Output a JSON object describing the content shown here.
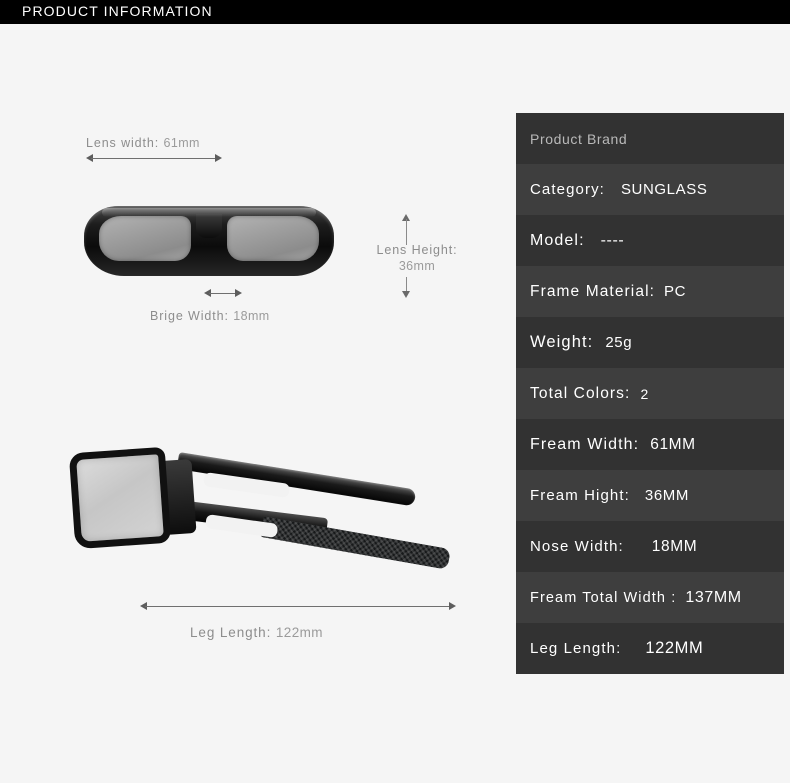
{
  "header": {
    "title": "PRODUCT INFORMATION"
  },
  "diagram": {
    "front_view": {
      "lens_width": {
        "label": "Lens width:",
        "value": "61mm"
      },
      "lens_height": {
        "label": "Lens Height:",
        "value": "36mm"
      },
      "bridge_width": {
        "label": "Brige Width:",
        "value": "18mm"
      }
    },
    "side_view": {
      "leg_length": {
        "label": "Leg Length:",
        "value": "122mm"
      }
    }
  },
  "spec_table": {
    "rows": [
      {
        "label": "Product Brand",
        "value": ""
      },
      {
        "label": "Category:",
        "value": "SUNGLASS"
      },
      {
        "label": "Model:",
        "value": "----"
      },
      {
        "label": "Frame Material:",
        "value": "PC"
      },
      {
        "label": "Weight:",
        "value": "25g"
      },
      {
        "label": "Total Colors:",
        "value": "2"
      },
      {
        "label": "Fream Width:",
        "value": "61MM"
      },
      {
        "label": "Fream Hight:",
        "value": "36MM"
      },
      {
        "label": "Nose Width:",
        "value": "18MM"
      },
      {
        "label": "Fream Total Width :",
        "value": "137MM"
      },
      {
        "label": "Leg Length:",
        "value": "122MM"
      }
    ]
  },
  "colors": {
    "page_background": "#f5f5f5",
    "header_background": "#000000",
    "header_text": "#ffffff",
    "row_dark": "#323232",
    "row_light": "#3e3e3e",
    "spec_text": "#ffffff",
    "dimension_text": "#8d8d8d",
    "frame_black": "#111111",
    "lens_gray": "#9e9e9e"
  }
}
